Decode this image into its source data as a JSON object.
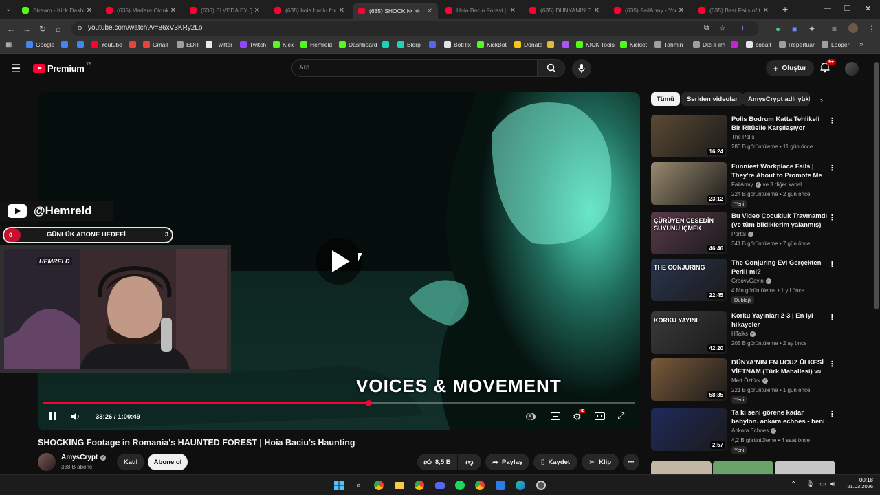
{
  "browser": {
    "tabs": [
      {
        "title": "Stream - Kick Dashb",
        "favicon_color": "#53fc18"
      },
      {
        "title": "(635) Madara Olduk",
        "favicon_color": "#ff0033"
      },
      {
        "title": "(635) ELVEDA EY ŞEY",
        "favicon_color": "#ff0033"
      },
      {
        "title": "(635) hoia baciu fore",
        "favicon_color": "#ff0033"
      },
      {
        "title": "(635) SHOCKING",
        "favicon_color": "#ff0033",
        "active": true
      },
      {
        "title": "Hoia Baciu Forest | T",
        "favicon_color": "#ff0033"
      },
      {
        "title": "(635) DÜNYANIN EN",
        "favicon_color": "#ff0033"
      },
      {
        "title": "(635) FailArmy - You",
        "favicon_color": "#ff0033"
      },
      {
        "title": "(635) Best Fails of th",
        "favicon_color": "#ff0033"
      }
    ],
    "new_tab": "+",
    "url": "youtube.com/watch?v=86xV3KRy2Lo",
    "bookmarks": [
      {
        "label": "Google",
        "color": "#4285f4"
      },
      {
        "label": "",
        "color": "#4285f4"
      },
      {
        "label": "",
        "color": "#4285f4"
      },
      {
        "label": "Youtube",
        "color": "#ff0033"
      },
      {
        "label": "",
        "color": "#ea4335"
      },
      {
        "label": "Gmail",
        "color": "#ea4335"
      },
      {
        "label": "EDIT",
        "color": "#9aa0a6"
      },
      {
        "label": "Twitter",
        "color": "#e7e9ea"
      },
      {
        "label": "Twitch",
        "color": "#9146ff"
      },
      {
        "label": "Kick",
        "color": "#53fc18"
      },
      {
        "label": "Hemreld",
        "color": "#53fc18"
      },
      {
        "label": "Dashboard",
        "color": "#53fc18"
      },
      {
        "label": "",
        "color": "#1fd1b5"
      },
      {
        "label": "Blerp",
        "color": "#1fd1b5"
      },
      {
        "label": "",
        "color": "#5865f2"
      },
      {
        "label": "BotRix",
        "color": "#e3e3e3"
      },
      {
        "label": "KickBot",
        "color": "#53fc18"
      },
      {
        "label": "Donate",
        "color": "#f5c518"
      },
      {
        "label": "",
        "color": "#e2b93b"
      },
      {
        "label": "",
        "color": "#a855f7"
      },
      {
        "label": "KICK Tools",
        "color": "#53fc18"
      },
      {
        "label": "Kicklet",
        "color": "#53fc18"
      },
      {
        "label": "Tahmin",
        "color": "#9aa0a6"
      },
      {
        "label": "Dizi-Film",
        "color": "#9aa0a6"
      },
      {
        "label": "",
        "color": "#c026d3"
      },
      {
        "label": "cobalt",
        "color": "#e3e3e3"
      },
      {
        "label": "Repertuar",
        "color": "#9aa0a6"
      },
      {
        "label": "Looper",
        "color": "#9aa0a6"
      }
    ]
  },
  "youtube": {
    "logo_text": "Premium",
    "logo_sup": "TR",
    "search_placeholder": "Ara",
    "create_label": "Oluştur",
    "notifications_badge": "9+",
    "player": {
      "current_time": "33:26",
      "duration": "1:00:49",
      "time_display": "33:26 / 1:00:49",
      "progress": 0.55,
      "subtitle_overlay": "VOICES & MOVEMENT",
      "hd_badge": "HD"
    },
    "overlay": {
      "channel_handle": "@Hemreld",
      "goal_label": "GÜNLÜK ABONE HEDEFİ",
      "goal_current": "0",
      "goal_target": "3",
      "cam_logo": "HEMRELD"
    },
    "video_title": "SHOCKING Footage in Romania's HAUNTED FOREST | Hoia Baciu's Haunting",
    "channel": {
      "name": "AmysCrypt",
      "subscribers": "338 B abone",
      "join_label": "Katıl",
      "subscribe_label": "Abone ol"
    },
    "actions": {
      "likes": "8,5 B",
      "share": "Paylaş",
      "save": "Kaydet",
      "clip": "Klip"
    },
    "chips": [
      "Tümü",
      "Seriden videolar",
      "AmysCrypt adlı yükle"
    ],
    "recommendations": [
      {
        "title": "Polis Bodrum Katta Tehlikeli Bir Ritüelle Karşılaşıyor",
        "channel": "The Polis",
        "verified": false,
        "meta": "280 B görüntüleme • 11 gün önce",
        "duration": "16:24",
        "badge": "",
        "thumb_color": "#5c4a32"
      },
      {
        "title": "Funniest Workplace Fails | They're About to Promote Me t...",
        "channel": "FailArmy",
        "channel_extra": "ve 3 diğer kanal",
        "verified": true,
        "meta": "224 B görüntüleme • 2 gün önce",
        "duration": "23:12",
        "badge": "Yeni",
        "thumb_color": "#9a8a6e"
      },
      {
        "title": "Bu Video Çocukluk Travmamdı (ve tüm bildiklerim yalanmış)",
        "channel": "Portal",
        "verified": true,
        "meta": "341 B görüntüleme • 7 gün önce",
        "duration": "46:46",
        "badge": "",
        "thumb_color": "#5a3a4a",
        "thumb_text": "ÇÜRÜYEN CESEDİN SUYUNU İÇMEK"
      },
      {
        "title": "The Conjuring Evi Gerçekten Perili mi?",
        "channel": "GroovyGavin",
        "verified": true,
        "meta": "4 Mn görüntüleme • 1 yıl önce",
        "duration": "22:45",
        "badge": "Dublajlı",
        "thumb_color": "#2a3550",
        "thumb_text": "THE CONJURING"
      },
      {
        "title": "Korku Yayınları 2-3 | En iyi hikayeler",
        "channel": "HTalks",
        "verified": true,
        "meta": "205 B görüntüleme • 2 ay önce",
        "duration": "42:20",
        "badge": "",
        "thumb_color": "#3a3a3a",
        "thumb_text": "KORKU YAYINI"
      },
      {
        "title": "DÜNYA'NIN EN UCUZ ÜLKESİ VİETNAM (Türk Mahallesi)",
        "channel": "Mert Öztürk",
        "verified": true,
        "meta": "221 B görüntüleme • 1 gün önce",
        "duration": "58:35",
        "badge": "Yeni",
        "thumb_color": "#7a5a3a",
        "title_suffix": "VN"
      },
      {
        "title": "Ta ki seni görene kadar babylon. ankara echoes - beni al live",
        "channel": "Ankara Echoes",
        "verified": true,
        "meta": "4,2 B görüntüleme • 4 saat önce",
        "duration": "2:57",
        "badge": "Yeni",
        "thumb_color": "#1f2a5a"
      }
    ]
  },
  "taskbar": {
    "time": "00:18",
    "date": "21.03.2026"
  }
}
